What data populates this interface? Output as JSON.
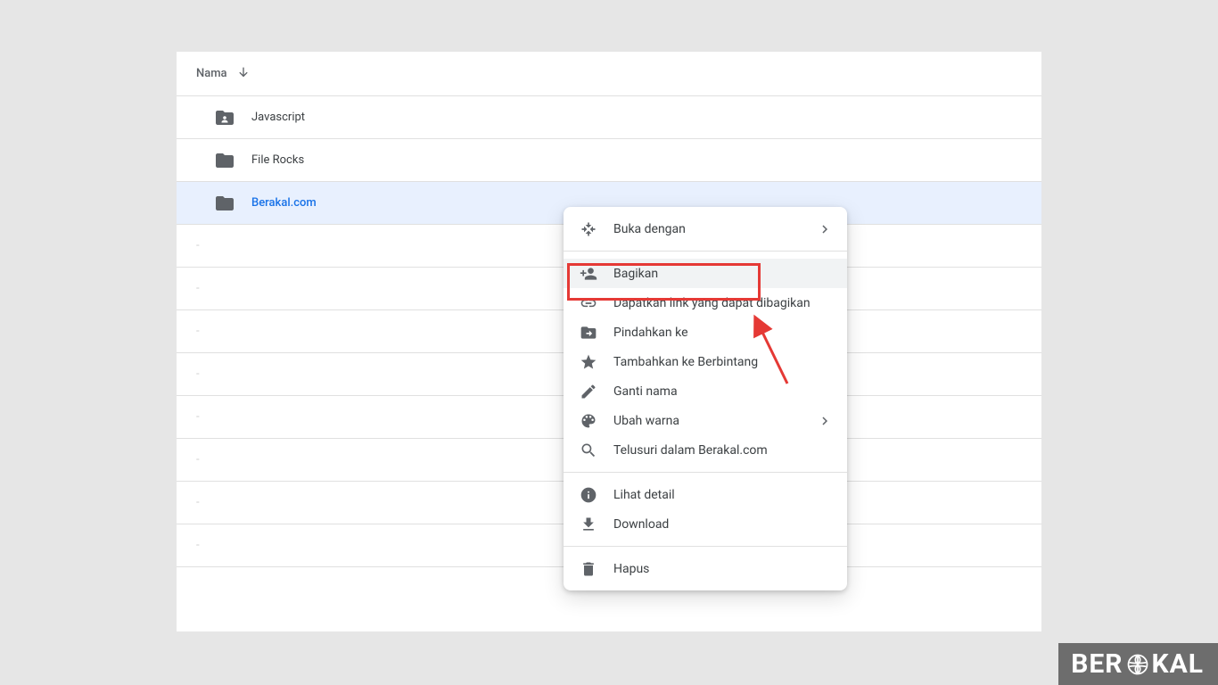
{
  "header": {
    "name_label": "Nama"
  },
  "rows": [
    {
      "name": "Javascript",
      "icon": "shared-folder",
      "selected": false
    },
    {
      "name": "File Rocks",
      "icon": "folder",
      "selected": false
    },
    {
      "name": "Berakal.com",
      "icon": "folder",
      "selected": true
    }
  ],
  "menu": {
    "open_with": "Buka dengan",
    "share": "Bagikan",
    "get_link": "Dapatkan link yang dapat dibagikan",
    "move_to": "Pindahkan ke",
    "add_star": "Tambahkan ke Berbintang",
    "rename": "Ganti nama",
    "change_color": "Ubah warna",
    "search_within": "Telusuri dalam Berakal.com",
    "view_detail": "Lihat detail",
    "download": "Download",
    "remove": "Hapus"
  },
  "watermark": {
    "pre": "BER",
    "post": "KAL"
  }
}
